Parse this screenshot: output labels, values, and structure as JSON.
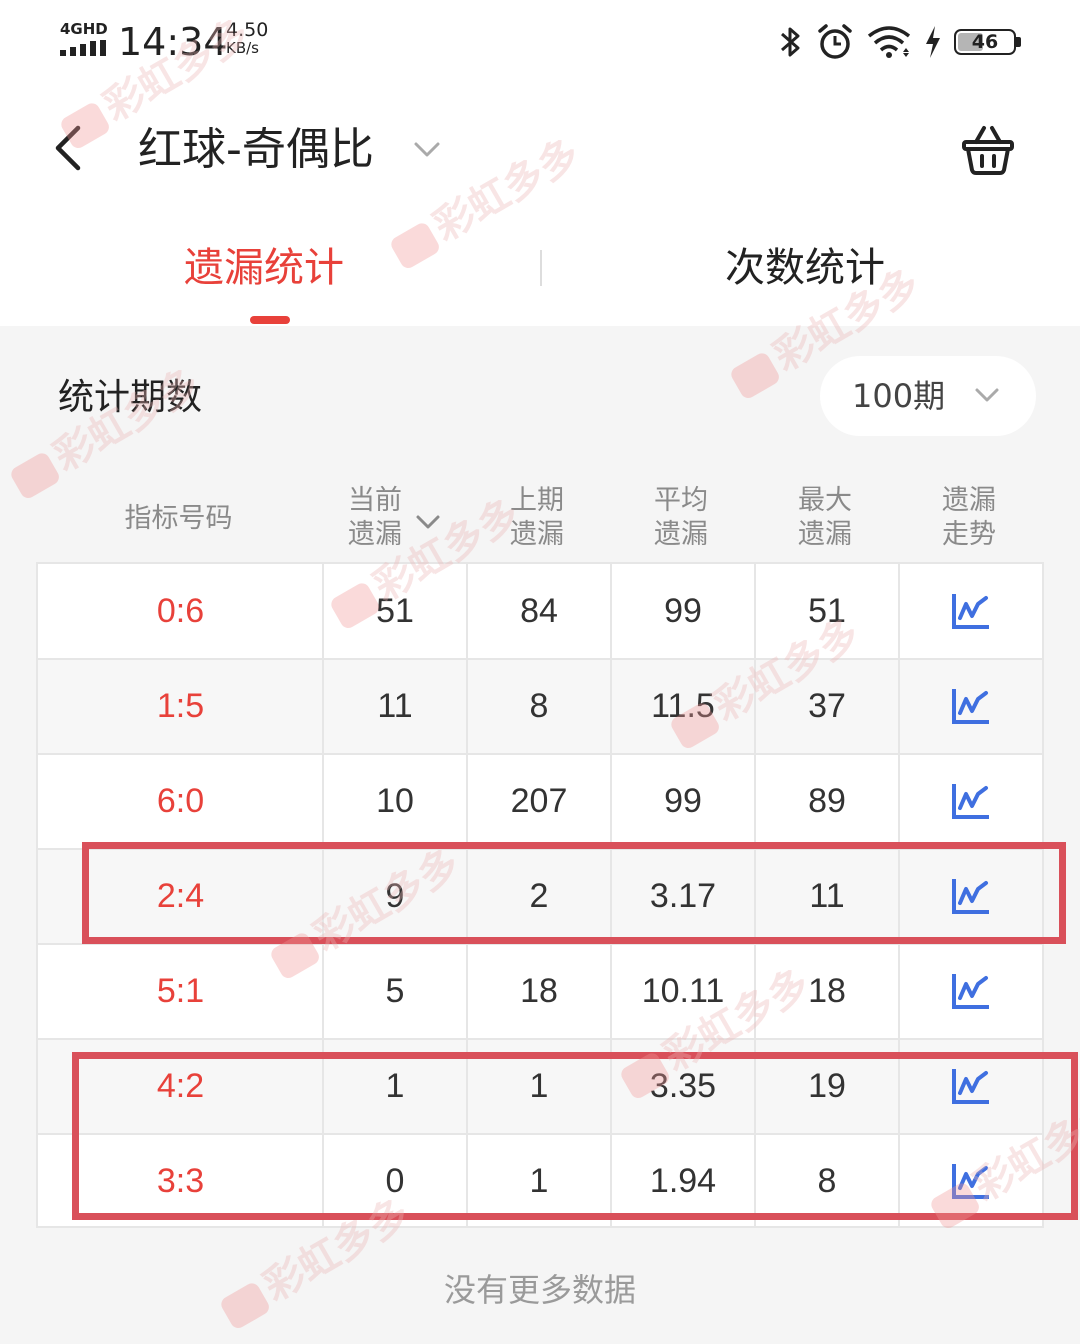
{
  "status_bar": {
    "network": "4GHD",
    "time": "14:34",
    "speed_value": "4.50",
    "speed_unit": "KB/s",
    "battery": "46",
    "battery_level_pct": 46
  },
  "nav": {
    "title": "红球-奇偶比"
  },
  "tabs": [
    {
      "label": "遗漏统计",
      "active": true
    },
    {
      "label": "次数统计",
      "active": false
    }
  ],
  "period": {
    "label": "统计期数",
    "selected": "100期"
  },
  "table": {
    "headers": [
      [
        "指标号码"
      ],
      [
        "当前",
        "遗漏"
      ],
      [
        "上期",
        "遗漏"
      ],
      [
        "平均",
        "遗漏"
      ],
      [
        "最大",
        "遗漏"
      ],
      [
        "遗漏",
        "走势"
      ]
    ],
    "rows": [
      {
        "code": "0:6",
        "current": "51",
        "last": "84",
        "avg": "99",
        "max": "51"
      },
      {
        "code": "1:5",
        "current": "11",
        "last": "8",
        "avg": "11.5",
        "max": "37"
      },
      {
        "code": "6:0",
        "current": "10",
        "last": "207",
        "avg": "99",
        "max": "89"
      },
      {
        "code": "2:4",
        "current": "9",
        "last": "2",
        "avg": "3.17",
        "max": "11"
      },
      {
        "code": "5:1",
        "current": "5",
        "last": "18",
        "avg": "10.11",
        "max": "18"
      },
      {
        "code": "4:2",
        "current": "1",
        "last": "1",
        "avg": "3.35",
        "max": "19"
      },
      {
        "code": "3:3",
        "current": "0",
        "last": "1",
        "avg": "1.94",
        "max": "8"
      }
    ]
  },
  "footer": "没有更多数据",
  "watermark": "彩虹多多",
  "colors": {
    "accent": "#e8413a",
    "highlight_box": "#d9505a",
    "trend_icon": "#3f6fe0"
  },
  "icons": [
    "back-arrow-icon",
    "chevron-down-icon",
    "basket-icon",
    "trend-chart-icon",
    "bluetooth-icon",
    "alarm-icon",
    "wifi-icon",
    "charging-icon",
    "battery-icon"
  ]
}
